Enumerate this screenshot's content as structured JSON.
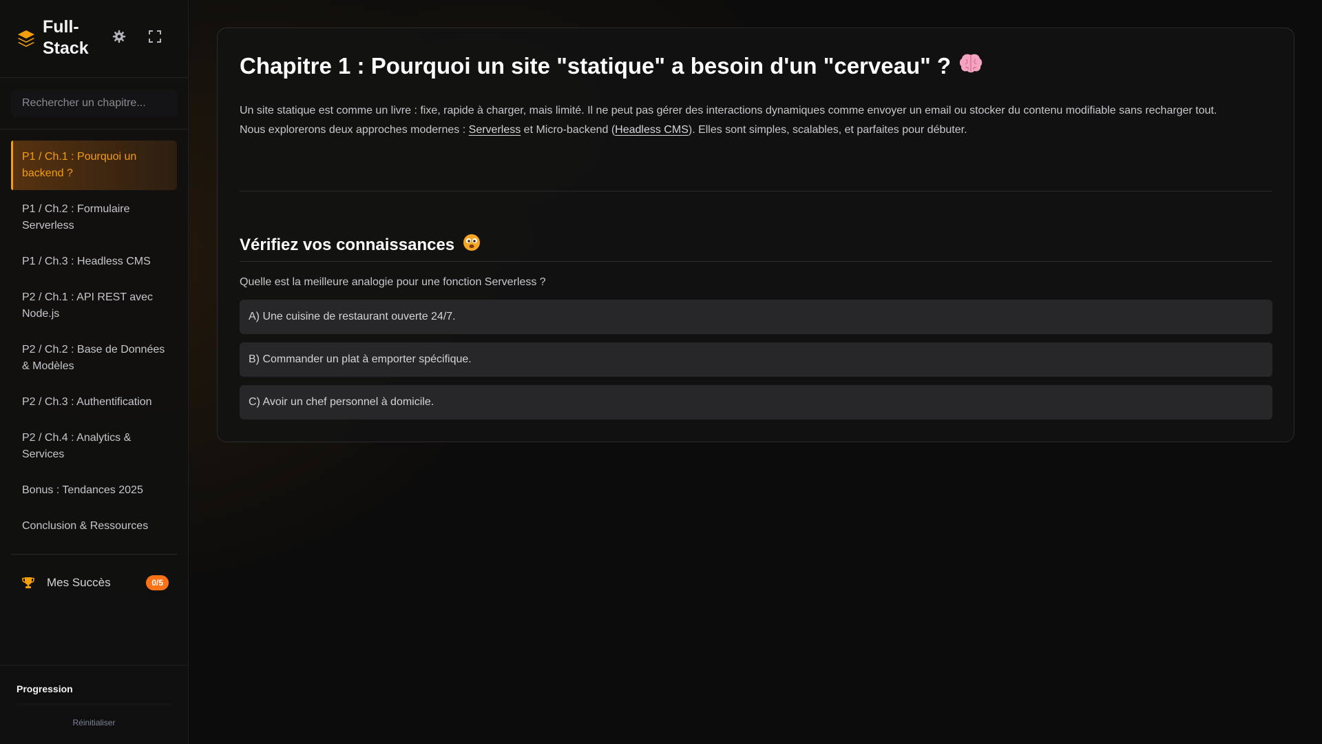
{
  "app": {
    "title": "Full-Stack",
    "accent_color": "#f59e0b",
    "logo_icon": "layers-icon",
    "settings_icon": "gear-icon",
    "fullscreen_icon": "fullscreen-icon"
  },
  "search": {
    "placeholder": "Rechercher un chapitre..."
  },
  "sidebar": {
    "items": [
      {
        "label": "P1 / Ch.1 : Pourquoi un backend ?",
        "active": true
      },
      {
        "label": "P1 / Ch.2 : Formulaire Serverless"
      },
      {
        "label": "P1 / Ch.3 : Headless CMS"
      },
      {
        "label": "P2 / Ch.1 : API REST avec Node.js"
      },
      {
        "label": "P2 / Ch.2 : Base de Données & Modèles"
      },
      {
        "label": "P2 / Ch.3 : Authentification"
      },
      {
        "label": "P2 / Ch.4 : Analytics & Services"
      },
      {
        "label": "Bonus : Tendances 2025"
      },
      {
        "label": "Conclusion & Ressources"
      }
    ],
    "achievements": {
      "icon": "trophy-icon",
      "label": "Mes Succès",
      "badge": "0/5"
    }
  },
  "progress": {
    "label": "Progression",
    "value": 0,
    "reset_label": "Réinitialiser"
  },
  "chapter": {
    "title": "Chapitre 1 : Pourquoi un site \"statique\" a besoin d'un \"cerveau\" ?",
    "title_icon": "brain-icon",
    "intro_line1": "Un site statique est comme un livre : fixe, rapide à charger, mais limité. Il ne peut pas gérer des interactions dynamiques comme envoyer un email ou stocker du contenu modifiable sans recharger tout.",
    "intro_line2_a": "Nous explorerons deux approches modernes : ",
    "intro_link1": "Serverless",
    "intro_line2_b": " et Micro-backend (",
    "intro_link2": "Headless CMS",
    "intro_line2_c": "). Elles sont simples, scalables, et parfaites pour débuter."
  },
  "quiz": {
    "title": "Vérifiez vos connaissances",
    "title_icon": "thinking-face-icon",
    "question": "Quelle est la meilleure analogie pour une fonction Serverless ?",
    "options": [
      "A) Une cuisine de restaurant ouverte 24/7.",
      "B) Commander un plat à emporter spécifique.",
      "C) Avoir un chef personnel à domicile."
    ]
  }
}
